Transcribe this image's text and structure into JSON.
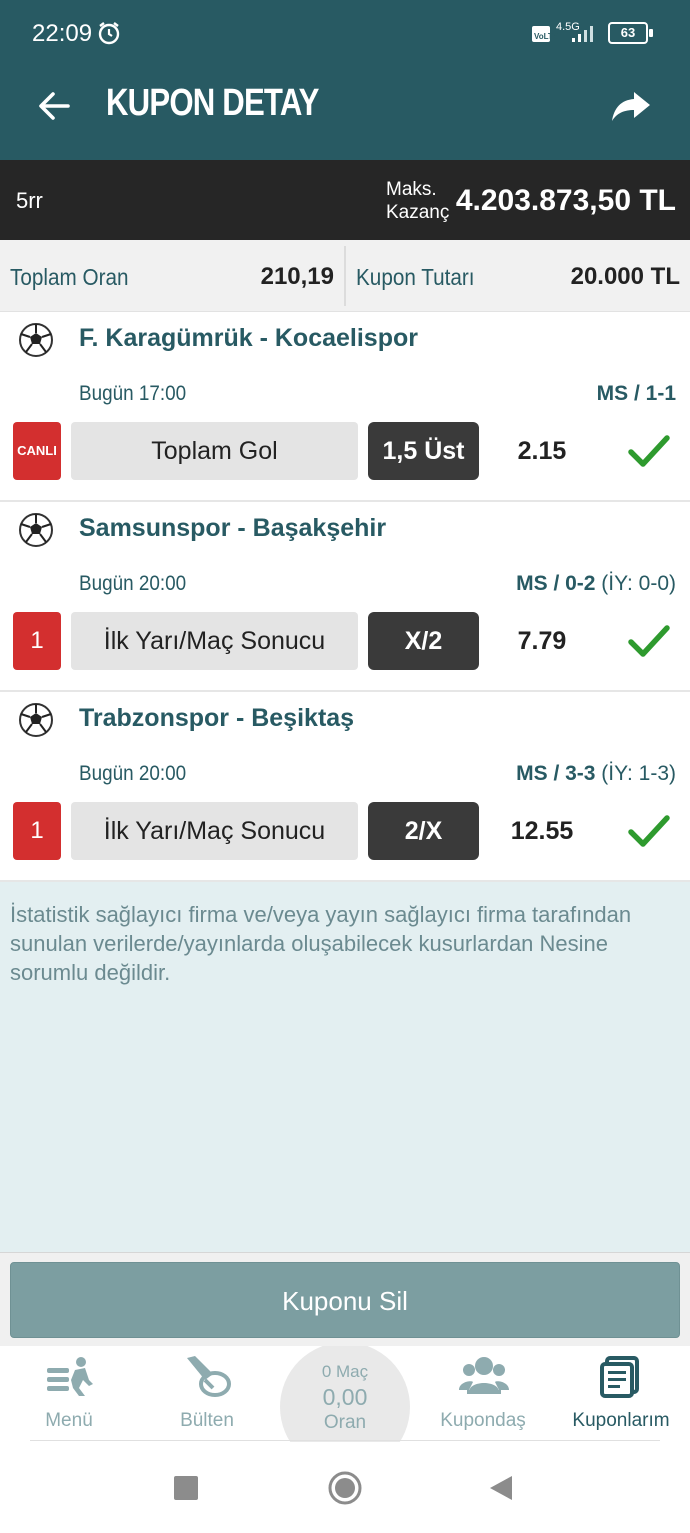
{
  "status_bar": {
    "time": "22:09",
    "network": "4.5G",
    "battery": "63"
  },
  "header": {
    "title": "KUPON DETAY"
  },
  "coupon": {
    "name": "5rr",
    "max_label_line1": "Maks.",
    "max_label_line2": "Kazanç",
    "max_value": "4.203.873,50 TL"
  },
  "totals": {
    "total_odds_label": "Toplam Oran",
    "total_odds_value": "210,19",
    "amount_label": "Kupon Tutarı",
    "amount_value": "20.000 TL"
  },
  "matches": [
    {
      "teams": "F. Karagümrük - Kocaelispor",
      "time": "Bugün 17:00",
      "result_bold": "MS / 1-1",
      "result_extra": "",
      "badge": "CANLI",
      "market": "Toplam Gol",
      "pick": "1,5 Üst",
      "odd": "2.15"
    },
    {
      "teams": "Samsunspor - Başakşehir",
      "time": "Bugün 20:00",
      "result_bold": "MS / 0-2",
      "result_extra": " (İY: 0-0)",
      "badge": "1",
      "market": "İlk Yarı/Maç Sonucu",
      "pick": "X/2",
      "odd": "7.79"
    },
    {
      "teams": "Trabzonspor - Beşiktaş",
      "time": "Bugün 20:00",
      "result_bold": "MS / 3-3",
      "result_extra": " (İY: 1-3)",
      "badge": "1",
      "market": "İlk Yarı/Maç Sonucu",
      "pick": "2/X",
      "odd": "12.55"
    }
  ],
  "disclaimer": "İstatistik sağlayıcı firma ve/veya yayın sağlayıcı firma tarafından sunulan verilerde/yayınlarda oluşabilecek kusurlardan Nesine sorumlu değildir.",
  "delete_button": "Kuponu Sil",
  "bottom_nav": {
    "menu": "Menü",
    "bulletin": "Bülten",
    "center_count": "0 Maç",
    "center_odds": "0,00",
    "center_label": "Oran",
    "kupondas": "Kupondaş",
    "kuponlarim": "Kuponlarım"
  },
  "colors": {
    "header": "#285a63",
    "accent_green": "#2e9a2e",
    "badge_red": "#d32f2f"
  }
}
